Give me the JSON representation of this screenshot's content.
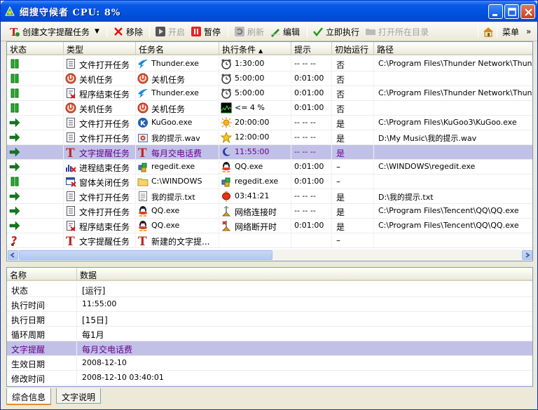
{
  "window": {
    "title": "细搜守候者  CPU: 8%"
  },
  "toolbar": {
    "create": "创建文字提醒任务",
    "remove": "移除",
    "start": "开启",
    "pause": "暂停",
    "refresh": "刷新",
    "edit": "编辑",
    "run_now": "立即执行",
    "open_dir": "打开所在目录",
    "menu": "菜单",
    "more": "»"
  },
  "columns": [
    "状态",
    "类型",
    "任务名",
    "执行条件",
    "提示",
    "初始运行",
    "路径"
  ],
  "rows": [
    {
      "status": "pause",
      "type_icon": "doc",
      "type": "文件打开任务",
      "name_icon": "thunder",
      "name": "Thunder.exe",
      "cond_icon": "clock",
      "cond": "1:30:00",
      "tip": "-- -- --",
      "init": "否",
      "path": "C:\\Program Files\\Thunder Network\\Thunder\\Th"
    },
    {
      "status": "pause",
      "type_icon": "power",
      "type": "关机任务",
      "name_icon": "power",
      "name": "关机任务",
      "cond_icon": "clock",
      "cond": "5:00:00",
      "tip": "0:01:00",
      "init": "否",
      "path": ""
    },
    {
      "status": "pause",
      "type_icon": "docx",
      "type": "程序结束任务",
      "name_icon": "thunder",
      "name": "Thunder.exe",
      "cond_icon": "clock",
      "cond": "5:00:00",
      "tip": "0:01:00",
      "init": "否",
      "path": "C:\\Program Files\\Thunder Network\\Thunder\\Th"
    },
    {
      "status": "pause",
      "type_icon": "power",
      "type": "关机任务",
      "name_icon": "power",
      "name": "关机任务",
      "cond_icon": "cpu",
      "cond": "<= 4 %",
      "tip": "0:01:00",
      "init": "否",
      "path": ""
    },
    {
      "status": "run",
      "type_icon": "doc",
      "type": "文件打开任务",
      "name_icon": "kugoo",
      "name": "KuGoo.exe",
      "cond_icon": "sun",
      "cond": "20:00:00",
      "tip": "-- -- --",
      "init": "是",
      "path": "C:\\Program Files\\KuGoo3\\KuGoo.exe"
    },
    {
      "status": "run",
      "type_icon": "doc",
      "type": "文件打开任务",
      "name_icon": "wav",
      "name": "我的提示.wav",
      "cond_icon": "star",
      "cond": "12:00:00",
      "tip": "-- -- --",
      "init": "是",
      "path": "D:\\My Music\\我的提示.wav"
    },
    {
      "status": "run",
      "type_icon": "T",
      "type": "文字提醒任务",
      "name_icon": "T",
      "name": "每月交电话费",
      "cond_icon": "moon",
      "cond": "11:55:00",
      "tip": "-- -- --",
      "init": "是",
      "path": "",
      "selected": true
    },
    {
      "status": "run",
      "type_icon": "proc",
      "type": "进程结束任务",
      "name_icon": "regedit",
      "name": "regedit.exe",
      "cond_icon": "qq",
      "cond": "QQ.exe",
      "tip": "0:01:00",
      "init": "–",
      "path": "C:\\WINDOWS\\regedit.exe"
    },
    {
      "status": "pause",
      "type_icon": "win",
      "type": "窗体关闭任务",
      "name_icon": "folder",
      "name": "C:\\WINDOWS",
      "cond_icon": "regedit",
      "cond": "regedit.exe",
      "tip": "0:01:00",
      "init": "–",
      "path": ""
    },
    {
      "status": "run",
      "type_icon": "doc",
      "type": "文件打开任务",
      "name_icon": "txt",
      "name": "我的提示.txt",
      "cond_icon": "lantern",
      "cond": "03:41:21",
      "tip": "-- -- --",
      "init": "是",
      "path": "D:\\我的提示.txt"
    },
    {
      "status": "run",
      "type_icon": "doc",
      "type": "文件打开任务",
      "name_icon": "qq",
      "name": "QQ.exe",
      "cond_icon": "net",
      "cond": "网络连接时",
      "tip": "-- -- --",
      "init": "是",
      "path": "C:\\Program Files\\Tencent\\QQ\\QQ.exe"
    },
    {
      "status": "run",
      "type_icon": "docx",
      "type": "程序结束任务",
      "name_icon": "qq",
      "name": "QQ.exe",
      "cond_icon": "netx",
      "cond": "网络断开时",
      "tip": "0:01:00",
      "init": "是",
      "path": "C:\\Program Files\\Tencent\\QQ\\QQ.exe"
    },
    {
      "status": "question",
      "type_icon": "T",
      "type": "文字提醒任务",
      "name_icon": "T",
      "name": "新建的文字提...",
      "cond_icon": "",
      "cond": "",
      "tip": "",
      "init": "–",
      "path": ""
    }
  ],
  "detail": {
    "columns": [
      "名称",
      "数据"
    ],
    "rows": [
      {
        "k": "状态",
        "v": "[运行]"
      },
      {
        "k": "执行时间",
        "v": "11:55:00"
      },
      {
        "k": "执行日期",
        "v": "[15日]"
      },
      {
        "k": "循环周期",
        "v": "每1月"
      },
      {
        "k": "文字提醒",
        "v": "每月交电话费",
        "selected": true
      },
      {
        "k": "生效日期",
        "v": "2008-12-10"
      },
      {
        "k": "修改时间",
        "v": "2008-12-10 03:40:01"
      }
    ]
  },
  "tabs": [
    "综合信息",
    "文字说明"
  ]
}
